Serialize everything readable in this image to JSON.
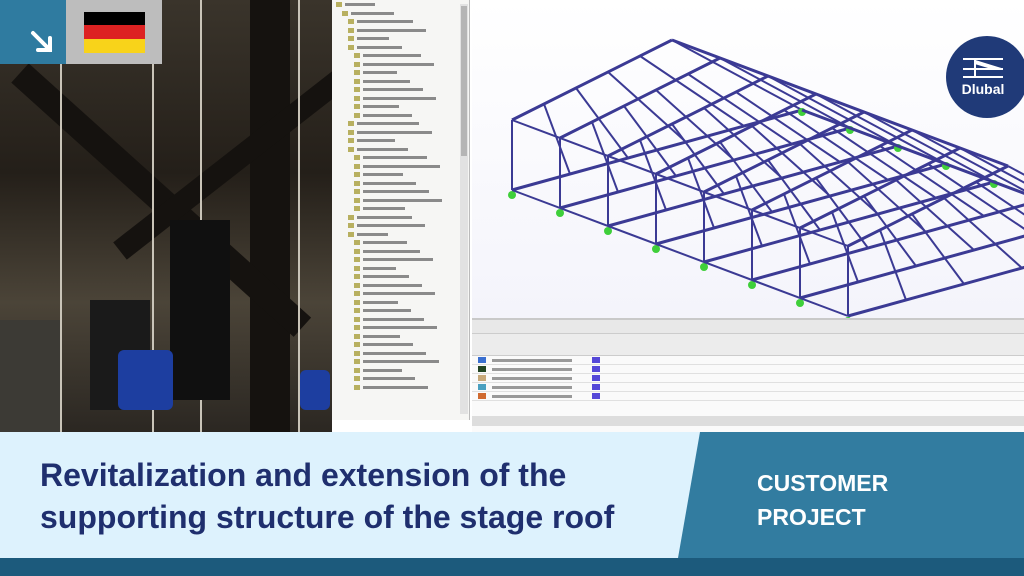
{
  "title": "Revitalization and extension of the supporting structure of the stage roof",
  "tag": {
    "line1": "CUSTOMER",
    "line2": "PROJECT"
  },
  "logo": {
    "text": "Dlubal"
  },
  "country_flag": "germany",
  "icons": {
    "badge": "arrow-down-right-icon"
  },
  "colors": {
    "accent": "#327ca0",
    "banner_bg": "#ddf2fd",
    "title": "#1f2f6e",
    "logo_bg": "#203a78",
    "footer": "#1c5a7c",
    "structure": "#3b3a94",
    "supports": "#3fcf3a"
  },
  "flag_colors": [
    "#000000",
    "#dd2222",
    "#f8d31a"
  ]
}
